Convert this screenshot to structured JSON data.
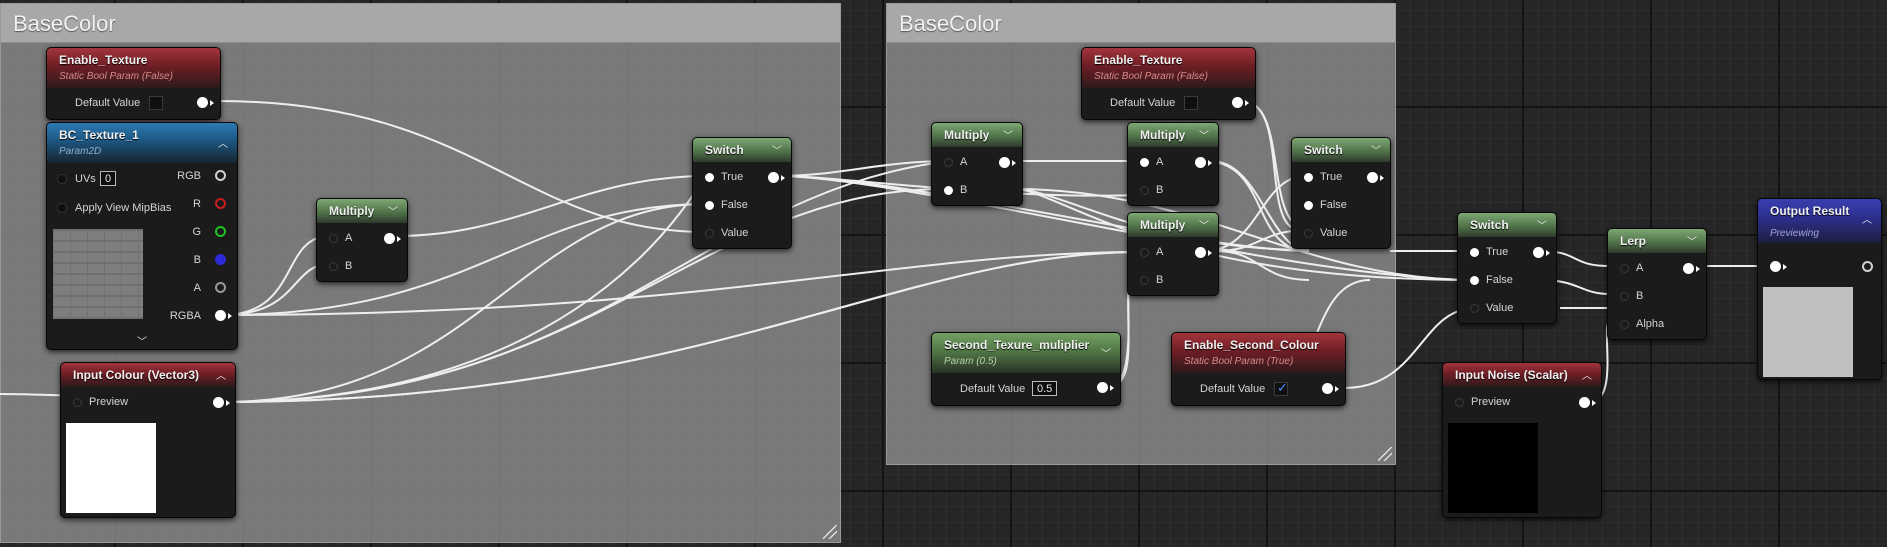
{
  "comments": [
    {
      "title": "BaseColor"
    },
    {
      "title": "BaseColor"
    }
  ],
  "nodes": {
    "enable_texture_1": {
      "title": "Enable_Texture",
      "subtitle": "Static Bool Param (False)",
      "default_label": "Default Value"
    },
    "bc_texture": {
      "title": "BC_Texture_1",
      "subtitle": "Param2D",
      "uvs_label": "UVs",
      "uvs_value": "0",
      "mip_label": "Apply View MipBias",
      "outputs": [
        "RGB",
        "R",
        "G",
        "B",
        "A",
        "RGBA"
      ]
    },
    "input_colour": {
      "title": "Input Colour (Vector3)",
      "preview_label": "Preview"
    },
    "multiply_1": {
      "title": "Multiply",
      "in_a": "A",
      "in_b": "B"
    },
    "switch_1": {
      "title": "Switch",
      "in_true": "True",
      "in_false": "False",
      "in_value": "Value"
    },
    "multiply_2": {
      "title": "Multiply",
      "in_a": "A",
      "in_b": "B"
    },
    "enable_texture_2": {
      "title": "Enable_Texture",
      "subtitle": "Static Bool Param (False)",
      "default_label": "Default Value"
    },
    "multiply_3": {
      "title": "Multiply",
      "in_a": "A",
      "in_b": "B"
    },
    "multiply_4": {
      "title": "Multiply",
      "in_a": "A",
      "in_b": "B"
    },
    "switch_2": {
      "title": "Switch",
      "in_true": "True",
      "in_false": "False",
      "in_value": "Value"
    },
    "second_texture_multiplier": {
      "title": "Second_Texure_muliplier",
      "subtitle": "Param (0.5)",
      "default_label": "Default Value",
      "default_value": "0.5"
    },
    "enable_second_colour": {
      "title": "Enable_Second_Colour",
      "subtitle": "Static Bool Param (True)",
      "default_label": "Default Value"
    },
    "switch_3": {
      "title": "Switch",
      "in_true": "True",
      "in_false": "False",
      "in_value": "Value"
    },
    "lerp": {
      "title": "Lerp",
      "in_a": "A",
      "in_b": "B",
      "in_alpha": "Alpha"
    },
    "input_noise": {
      "title": "Input Noise (Scalar)",
      "preview_label": "Preview"
    },
    "output_result": {
      "title": "Output Result",
      "subtitle": "Previewing"
    }
  },
  "colors": {
    "pin_r": "#c81e1e",
    "pin_g": "#22c422",
    "pin_b": "#2a2ad6",
    "input_colour_preview": "#ffffff",
    "input_noise_preview": "#000000",
    "output_preview": "#c0c0c0"
  }
}
